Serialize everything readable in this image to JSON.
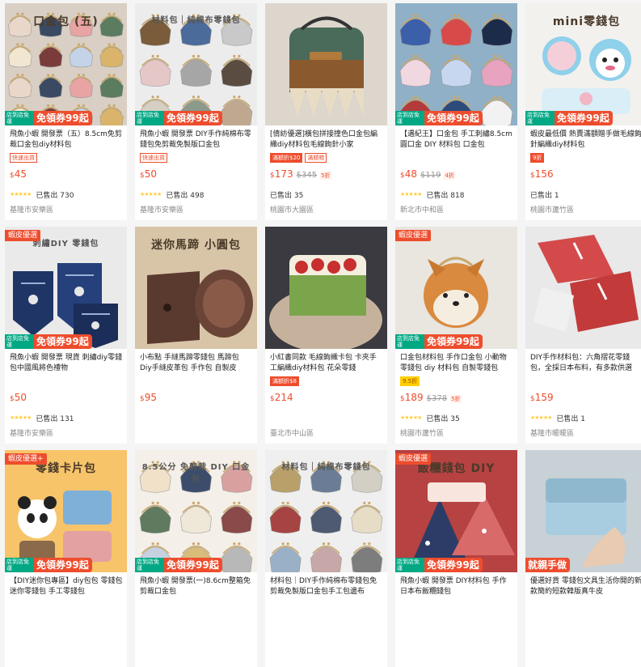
{
  "colors": {
    "accent": "#ee4d2d",
    "ship_green": "#00a884",
    "star": "#ffce3d"
  },
  "icons": {
    "star": "star-icon",
    "fish": "fish-icon"
  },
  "products": [
    {
      "banner": "",
      "ship_left": "店到店免運",
      "ship_right": "免領券99起",
      "overlay": "口金包 (五)",
      "title": "飛魚小蝦 開發票（五）8.5cm免剪裁口金包diy材料包",
      "badges": [
        {
          "text": "快速出貨",
          "style": "outline"
        }
      ],
      "currency": "$",
      "price": "45",
      "orig": "",
      "disc": "",
      "stars": "★★★★★",
      "sold": "已售出 730",
      "loc": "基隆市安樂區",
      "scene": "pouches_many"
    },
    {
      "banner": "",
      "ship_left": "店到店免運",
      "ship_right": "免領券99起",
      "overlay": "材料包｜純棉布零錢包",
      "title": "飛魚小蝦 開發票 DIY手作純棉布零錢包免剪裁免製版口金包",
      "badges": [
        {
          "text": "快速出貨",
          "style": "outline"
        }
      ],
      "currency": "$",
      "price": "50",
      "orig": "",
      "disc": "",
      "stars": "★★★★★",
      "sold": "已售出 498",
      "loc": "基隆市安樂區",
      "scene": "pouches_grid"
    },
    {
      "banner": "",
      "ship_left": "",
      "ship_right": "",
      "overlay": "",
      "title": "[倩紡優選]橫包拼接撞色口金包編織diy材料包毛線鉤針小家",
      "badges": [
        {
          "text": "滿額折$20",
          "style": "fill"
        },
        {
          "text": "滿額贈",
          "style": "outline"
        }
      ],
      "currency": "$",
      "price": "173",
      "orig": "$345",
      "disc": "5折",
      "stars": "",
      "sold": "已售出 35",
      "loc": "桃園市大園區",
      "scene": "knit_bag"
    },
    {
      "banner": "",
      "ship_left": "店到店免運",
      "ship_right": "免領券99起",
      "overlay": "",
      "title": "【遇紀王】口金包 手工刺繡8.5cm 圓口金 DIY 材料包 口金包",
      "badges": [],
      "currency": "$",
      "price": "48",
      "orig": "$119",
      "disc": "4折",
      "stars": "★★★★★",
      "sold": "已售出 818",
      "loc": "新北市中和區",
      "scene": "pouches_colorful"
    },
    {
      "banner": "",
      "ship_left": "店到店免運",
      "ship_right": "免領券99起",
      "overlay": "mini零錢包",
      "title": "蝦皮最低價 熱賣滿額贈手做毛線鉤針編織diy材料包",
      "badges": [
        {
          "text": "9折",
          "style": "fill"
        }
      ],
      "currency": "$",
      "price": "156",
      "orig": "",
      "disc": "",
      "stars": "",
      "sold": "已售出 1",
      "loc": "桃園市蘆竹區",
      "scene": "crochet_toys"
    },
    {
      "banner": "蝦皮優選",
      "ship_left": "店到店免運",
      "ship_right": "免領券99起",
      "overlay": "刺繡DIY 零錢包",
      "title": "飛魚小蝦 開發票 現貨 刺繡diy零錢包中國風將色禮物",
      "badges": [],
      "currency": "$",
      "price": "50",
      "orig": "",
      "disc": "",
      "stars": "★★★★★",
      "sold": "已售出 131",
      "loc": "基隆市安樂區",
      "scene": "embroidery"
    },
    {
      "banner": "",
      "ship_left": "",
      "ship_right": "",
      "overlay": "迷你馬蹄 小圓包",
      "title": "小布點 手縫馬蹄零錢包 馬蹄包 Diy手縫皮革包 手作包 自製皮",
      "badges": [],
      "currency": "$",
      "price": "95",
      "orig": "",
      "disc": "",
      "stars": "",
      "sold": "",
      "loc": "",
      "scene": "leather"
    },
    {
      "banner": "",
      "ship_left": "",
      "ship_right": "",
      "overlay": "",
      "title": "小紅書同款 毛線鉤織卡包 卡夾手工編織diy材料包 花朵零錢",
      "badges": [
        {
          "text": "滿額折$8",
          "style": "fill"
        }
      ],
      "currency": "$",
      "price": "214",
      "orig": "",
      "disc": "",
      "stars": "",
      "sold": "",
      "loc": "臺北市中山區",
      "scene": "flower_card"
    },
    {
      "banner": "蝦皮優選",
      "ship_left": "店到店免運",
      "ship_right": "免領券99起",
      "overlay": "",
      "title": "口金包材料包 手作口金包 小動物零錢包 diy 材料包 自製零錢包",
      "badges": [
        {
          "text": "9.5折",
          "style": "yellow"
        }
      ],
      "currency": "$",
      "price": "189",
      "orig": "$378",
      "disc": "5折",
      "stars": "★★★★★",
      "sold": "已售出 35",
      "loc": "桃園市蘆竹區",
      "scene": "shiba"
    },
    {
      "banner": "",
      "ship_left": "",
      "ship_right": "",
      "overlay": "",
      "title": "DIY手作材料包：六角摺花零錢包，全採日本布料，有多款供選",
      "badges": [],
      "currency": "$",
      "price": "159",
      "orig": "",
      "disc": "",
      "stars": "★★★★★",
      "sold": "已售出 1",
      "loc": "基隆市暖暖區",
      "scene": "hex_fabric"
    },
    {
      "banner": "蝦皮優選+",
      "ship_left": "店到店免運",
      "ship_right": "免領券99起",
      "overlay": "零錢卡片包",
      "title": "【DIY迷你包專區】diy包包 零錢包 迷你零錢包 手工零錢包",
      "badges": [],
      "currency": "$",
      "price": "",
      "orig": "",
      "disc": "",
      "stars": "",
      "sold": "",
      "loc": "",
      "scene": "panda"
    },
    {
      "banner": "",
      "ship_left": "店到店免運",
      "ship_right": "免領券99起",
      "overlay": "8.5公分 免剪裁 DIY 口金包",
      "title": "飛魚小蝦 開發票(一)8.6cm整箱免剪裁口金包",
      "badges": [],
      "currency": "$",
      "price": "",
      "orig": "",
      "disc": "",
      "stars": "",
      "sold": "",
      "loc": "",
      "scene": "pouches_set"
    },
    {
      "banner": "",
      "ship_left": "",
      "ship_right": "",
      "overlay": "材料包｜純棉布零錢包",
      "title": "材料包｜DIY手作純棉布零錢包免剪裁免製版口金包手工包邊布",
      "badges": [],
      "currency": "$",
      "price": "",
      "orig": "",
      "disc": "",
      "stars": "",
      "sold": "",
      "loc": "",
      "scene": "pouches_grid2"
    },
    {
      "banner": "蝦皮優選",
      "ship_left": "店到店免運",
      "ship_right": "免領券99起",
      "overlay": "飯糰錢包 DIY",
      "title": "飛魚小蝦 開發票 DIY材料包 手作 日本布飯糰錢包",
      "badges": [],
      "currency": "$",
      "price": "",
      "orig": "",
      "disc": "",
      "stars": "",
      "sold": "",
      "loc": "",
      "scene": "onigiri"
    },
    {
      "banner": "",
      "ship_left": "",
      "ship_right": "就親手做",
      "overlay": "",
      "title": "優選好貨 零錢包文具生活你開的新款簡約短款韓版真牛皮",
      "badges": [],
      "currency": "$",
      "price": "",
      "orig": "",
      "disc": "",
      "stars": "",
      "sold": "",
      "loc": "",
      "scene": "leather_blue"
    }
  ]
}
